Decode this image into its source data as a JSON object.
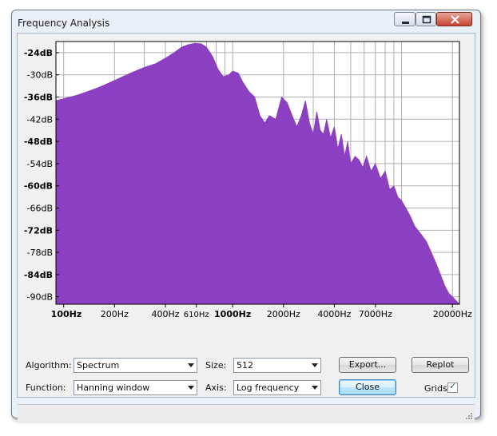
{
  "window": {
    "title": "Frequency Analysis"
  },
  "colors": {
    "spectrum_fill": "#8b3fc1",
    "plot_bg": "#ffffff",
    "grid": "#b0b0b0"
  },
  "chart_data": {
    "type": "area",
    "title": "",
    "xlabel": "",
    "ylabel": "",
    "xscale": "log",
    "xlim": [
      90,
      22000
    ],
    "ylim": [
      -92,
      -21
    ],
    "grid": true,
    "y_ticks": [
      {
        "value": -24,
        "label": "-24dB"
      },
      {
        "value": -30,
        "label": "-30dB"
      },
      {
        "value": -36,
        "label": "-36dB"
      },
      {
        "value": -42,
        "label": "-42dB"
      },
      {
        "value": -48,
        "label": "-48dB"
      },
      {
        "value": -54,
        "label": "-54dB"
      },
      {
        "value": -60,
        "label": "-60dB"
      },
      {
        "value": -66,
        "label": "-66dB"
      },
      {
        "value": -72,
        "label": "-72dB"
      },
      {
        "value": -78,
        "label": "-78dB"
      },
      {
        "value": -84,
        "label": "-84dB"
      },
      {
        "value": -90,
        "label": "-90dB"
      }
    ],
    "x_ticks": [
      {
        "value": 100,
        "label": "100Hz"
      },
      {
        "value": 200,
        "label": "200Hz"
      },
      {
        "value": 400,
        "label": "400Hz"
      },
      {
        "value": 610,
        "label": "610Hz"
      },
      {
        "value": 1000,
        "label": "1000Hz"
      },
      {
        "value": 2000,
        "label": "2000Hz"
      },
      {
        "value": 4000,
        "label": "4000Hz"
      },
      {
        "value": 7000,
        "label": "7000Hz"
      },
      {
        "value": 20000,
        "label": "20000Hz"
      }
    ],
    "series": [
      {
        "x": [
          90,
          120,
          160,
          200,
          250,
          300,
          350,
          400,
          450,
          500,
          550,
          600,
          650,
          700,
          760,
          820,
          880,
          950,
          1000,
          1080,
          1150,
          1250,
          1350,
          1450,
          1550,
          1650,
          1800,
          1950,
          2100,
          2250,
          2400,
          2550,
          2700,
          2850,
          3000,
          3150,
          3300,
          3450,
          3600,
          3800,
          4000,
          4200,
          4400,
          4600,
          4800,
          5000,
          5300,
          5600,
          5900,
          6200,
          6600,
          7000,
          7500,
          8000,
          8500,
          9000,
          9500,
          10000,
          10600,
          11200,
          12000,
          13000,
          14000,
          15000,
          16000,
          17000,
          18000,
          19000,
          20000,
          21000,
          22000
        ],
        "y": [
          -37,
          -35.5,
          -33.5,
          -31.5,
          -29.5,
          -28,
          -27,
          -25.5,
          -24,
          -22.5,
          -21.8,
          -21.5,
          -21.6,
          -22.5,
          -25,
          -28.5,
          -30.5,
          -30,
          -29,
          -29.5,
          -32,
          -34.5,
          -36,
          -41,
          -43,
          -41,
          -42,
          -36,
          -37.5,
          -41,
          -44,
          -41,
          -37,
          -43,
          -46,
          -40,
          -45,
          -46,
          -42,
          -47,
          -44,
          -50,
          -46,
          -52,
          -48,
          -54,
          -52,
          -53,
          -55,
          -52,
          -56,
          -54,
          -58,
          -56,
          -61,
          -60,
          -63,
          -64,
          -66,
          -68,
          -71,
          -73,
          -75,
          -78,
          -81,
          -84,
          -87,
          -89,
          -90,
          -91,
          -92
        ]
      }
    ]
  },
  "controls": {
    "algorithm_label": "Algorithm:",
    "algorithm_value": "Spectrum",
    "size_label": "Size:",
    "size_value": "512",
    "export_label": "Export...",
    "replot_label": "Replot",
    "function_label": "Function:",
    "function_value": "Hanning window",
    "axis_label": "Axis:",
    "axis_value": "Log frequency",
    "close_label": "Close",
    "grids_label": "Grids"
  },
  "icons": {
    "minimize": "minimize-icon",
    "maximize": "maximize-icon",
    "close": "close-icon",
    "grids_checked": "checkmark-icon"
  }
}
